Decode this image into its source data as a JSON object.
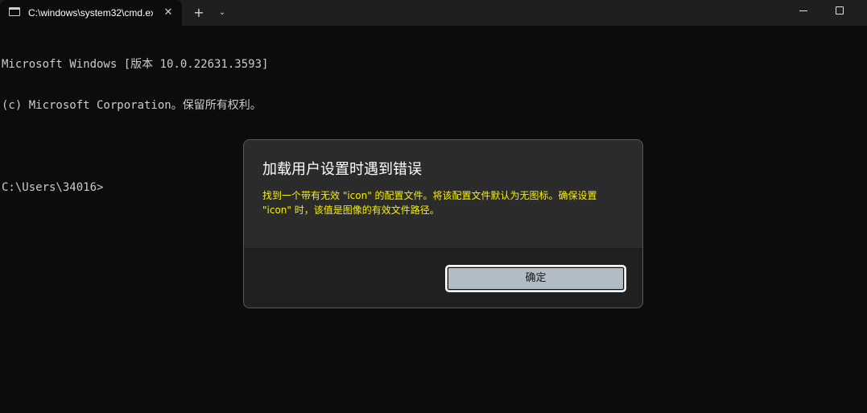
{
  "titlebar": {
    "tab_title": "C:\\windows\\system32\\cmd.exe",
    "tab_close_glyph": "✕",
    "new_tab_glyph": "+",
    "dropdown_glyph": "⌄",
    "icons": [
      "terminal-icon",
      "close-icon",
      "plus-icon",
      "chevron-down-icon",
      "minimize-icon",
      "maximize-icon"
    ]
  },
  "terminal": {
    "lines": [
      "Microsoft Windows [版本 10.0.22631.3593]",
      "(c) Microsoft Corporation。保留所有权利。",
      "",
      "C:\\Users\\34016>"
    ]
  },
  "dialog": {
    "title": "加载用户设置时遇到错误",
    "message": "找到一个带有无效 \"icon\" 的配置文件。将该配置文件默认为无图标。确保设置 \"icon\" 时，该值是图像的有效文件路径。",
    "ok_label": "确定"
  },
  "colors": {
    "terminal_bg": "#0c0c0c",
    "titlebar_bg": "#1f1f1f",
    "terminal_text": "#cccccc",
    "dialog_bg": "#2b2b2b",
    "dialog_footer_bg": "#202020",
    "warning_text": "#f9f100",
    "button_bg": "#b2bcc4"
  }
}
